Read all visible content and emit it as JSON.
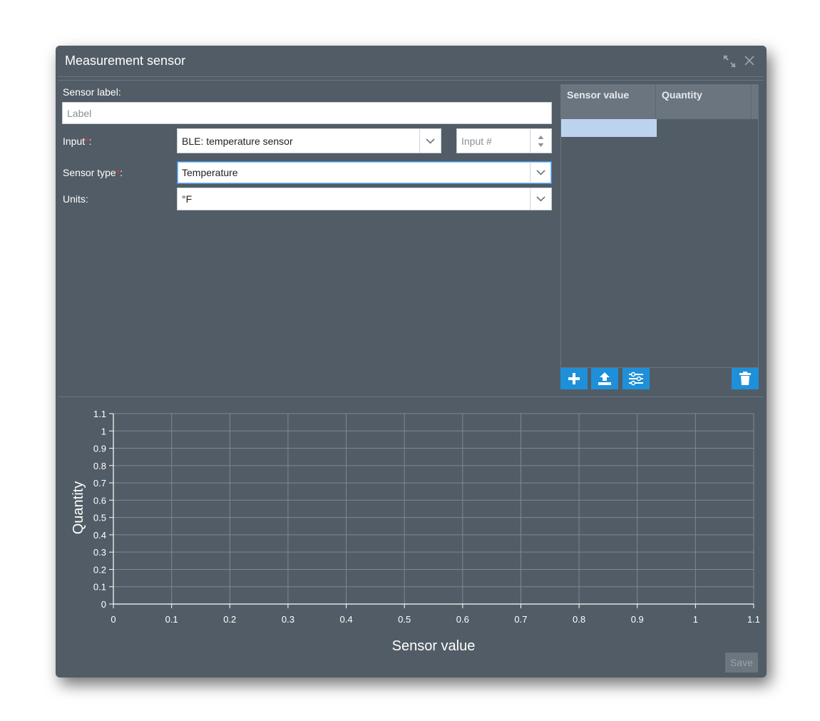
{
  "window": {
    "title": "Measurement sensor"
  },
  "form": {
    "sensor_label": {
      "label": "Sensor label:",
      "placeholder": "Label",
      "value": ""
    },
    "input": {
      "label": "Input",
      "required_mark": "*",
      "suffix": ":",
      "value": "BLE: temperature sensor",
      "number_placeholder": "Input #"
    },
    "sensor_type": {
      "label": "Sensor type",
      "required_mark": "*",
      "suffix": ":",
      "value": "Temperature"
    },
    "units": {
      "label": "Units:",
      "value": "°F"
    }
  },
  "table": {
    "columns": [
      "Sensor value",
      "Quantity"
    ],
    "rows": []
  },
  "toolbar": {
    "icons": [
      "plus-icon",
      "upload-icon",
      "sliders-icon",
      "trash-icon"
    ]
  },
  "save_label": "Save",
  "colors": {
    "accent": "#1e90d9",
    "dialog_bg": "#525c66",
    "required": "#e3342f"
  },
  "chart_data": {
    "type": "line",
    "series": [],
    "xlabel": "Sensor value",
    "ylabel": "Quantity",
    "xlim": [
      0,
      1.1
    ],
    "ylim": [
      0,
      1.1
    ],
    "xticks": [
      0,
      0.1,
      0.2,
      0.3,
      0.4,
      0.5,
      0.6,
      0.7,
      0.8,
      0.9,
      1,
      1.1
    ],
    "yticks": [
      0,
      0.1,
      0.2,
      0.3,
      0.4,
      0.5,
      0.6,
      0.7,
      0.8,
      0.9,
      1,
      1.1
    ],
    "grid": true
  }
}
